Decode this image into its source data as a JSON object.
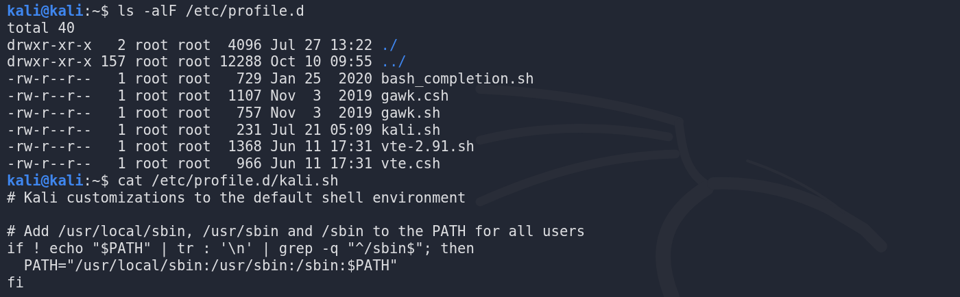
{
  "terminal": {
    "lines": [
      {
        "kind": "prompt",
        "prompt_host": "kali@kali",
        "prompt_tail": ":~$",
        "command": "ls -alF /etc/profile.d"
      },
      {
        "kind": "output",
        "text": "total 40"
      },
      {
        "kind": "entry",
        "info": "drwxr-xr-x   2 root root  4096 Jul 27 13:22",
        "name": "./",
        "directory": true
      },
      {
        "kind": "entry",
        "info": "drwxr-xr-x 157 root root 12288 Oct 10 09:55",
        "name": "../",
        "directory": true
      },
      {
        "kind": "entry",
        "info": "-rw-r--r--   1 root root   729 Jan 25  2020",
        "name": "bash_completion.sh",
        "directory": false
      },
      {
        "kind": "entry",
        "info": "-rw-r--r--   1 root root  1107 Nov  3  2019",
        "name": "gawk.csh",
        "directory": false
      },
      {
        "kind": "entry",
        "info": "-rw-r--r--   1 root root   757 Nov  3  2019",
        "name": "gawk.sh",
        "directory": false
      },
      {
        "kind": "entry",
        "info": "-rw-r--r--   1 root root   231 Jul 21 05:09",
        "name": "kali.sh",
        "directory": false
      },
      {
        "kind": "entry",
        "info": "-rw-r--r--   1 root root  1368 Jun 11 17:31",
        "name": "vte-2.91.sh",
        "directory": false
      },
      {
        "kind": "entry",
        "info": "-rw-r--r--   1 root root   966 Jun 11 17:31",
        "name": "vte.csh",
        "directory": false
      },
      {
        "kind": "prompt",
        "prompt_host": "kali@kali",
        "prompt_tail": ":~$",
        "command": "cat /etc/profile.d/kali.sh"
      },
      {
        "kind": "output",
        "text": "# Kali customizations to the default shell environment"
      },
      {
        "kind": "blank"
      },
      {
        "kind": "output",
        "text": "# Add /usr/local/sbin, /usr/sbin and /sbin to the PATH for all users"
      },
      {
        "kind": "output",
        "text": "if ! echo \"$PATH\" | tr : '\\n' | grep -q \"^/sbin$\"; then"
      },
      {
        "kind": "output",
        "text": "  PATH=\"/usr/local/sbin:/usr/sbin:/sbin:$PATH\""
      },
      {
        "kind": "output",
        "text": "fi"
      }
    ]
  }
}
